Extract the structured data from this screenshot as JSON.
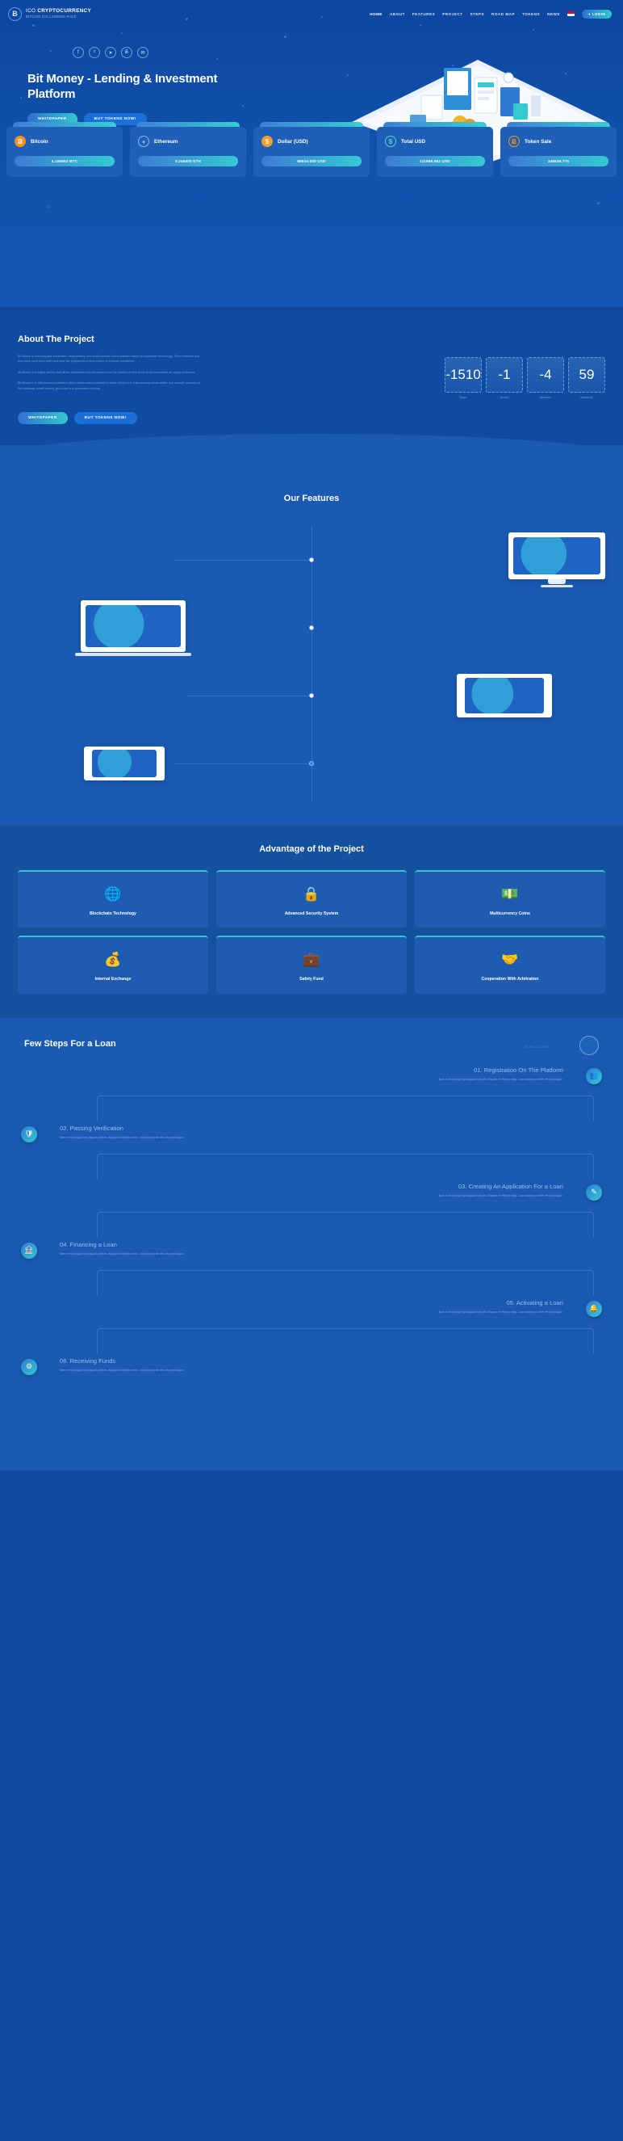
{
  "header": {
    "brand_line1_light": "ICO ",
    "brand_line1_bold": "CRYPTOCURRENCY",
    "brand_line2": "BITCOIN ICO LANDING PAGE",
    "logo_glyph": "Ƀ",
    "nav": [
      {
        "label": "HOME",
        "active": true
      },
      {
        "label": "ABOUT",
        "active": false
      },
      {
        "label": "FEATURES",
        "active": false
      },
      {
        "label": "PROJECT",
        "active": false
      },
      {
        "label": "STEPS",
        "active": false
      },
      {
        "label": "ROAD MAP",
        "active": false
      },
      {
        "label": "TOKENS",
        "active": false
      },
      {
        "label": "NEWS",
        "active": false
      }
    ],
    "login_label": "LOGIN",
    "login_icon": "👤",
    "flag_name": "flag-icon"
  },
  "hero": {
    "socials": [
      {
        "name": "facebook-icon",
        "glyph": "f"
      },
      {
        "name": "twitter-icon",
        "glyph": "ᴛ"
      },
      {
        "name": "telegram-icon",
        "glyph": "➤"
      },
      {
        "name": "bitcoin-icon",
        "glyph": "Ƀ"
      },
      {
        "name": "email-icon",
        "glyph": "✉"
      }
    ],
    "title": "Bit Money - Lending & Investment Platform",
    "btn_primary": "WHITEPAPER",
    "btn_secondary": "BUY TOKENS NOW!"
  },
  "tickers": [
    {
      "name": "Bitcoin",
      "value": "4.160651 BTC",
      "icon": "Ƀ",
      "icon_bg": "#f7931a",
      "icon_fg": "#ffffff"
    },
    {
      "name": "Ethereum",
      "value": "3.245000 ETH",
      "icon": "♦",
      "icon_bg": "transparent",
      "icon_fg": "#8fb6e8"
    },
    {
      "name": "Dollar (USD)",
      "value": "58634.000 USD",
      "icon": "$",
      "icon_bg": "#f0a02a",
      "icon_fg": "#ffffff"
    },
    {
      "name": "Total USD",
      "value": "111969.062 USD",
      "icon": "$",
      "icon_bg": "transparent",
      "icon_fg": "#4fd8c0"
    },
    {
      "name": "Token Sale",
      "value": "346636.775",
      "icon": "Ƀ",
      "icon_bg": "transparent",
      "icon_fg": "#f7931a"
    }
  ],
  "about": {
    "title": "About The Project",
    "paragraphs": [
      "Bit Money is a lending and investment, multicurrency and multifunctional online platform based on blockchain technology. There investors and borrowers meet each other and have the opportunity to lend money or evaluate investment.",
      "Bit Money is a unique service that allows individuals to invest money from the comfort of their home in the convenient on crypto currencies.",
      "Bit Money is a multi-functional platform which allows each participant to keep money in a multi-currency online wallet, buy and sell currency on the exchange, invest money, get a loan in a convenient currency."
    ],
    "btn_primary": "WHITEPAPER",
    "btn_secondary": "BUY TOKENS NOW!",
    "countdown": [
      {
        "value": "-1510",
        "label": "Days"
      },
      {
        "value": "-1",
        "label": "Hours"
      },
      {
        "value": "-4",
        "label": "Minutes"
      },
      {
        "value": "59",
        "label": "Seconds"
      }
    ]
  },
  "features": {
    "title": "Our Features",
    "items": [
      {
        "device": "desktop",
        "name": "feature-desktop"
      },
      {
        "device": "laptop",
        "name": "feature-laptop"
      },
      {
        "device": "tablet",
        "name": "feature-tablet"
      },
      {
        "device": "phone",
        "name": "feature-phone"
      }
    ]
  },
  "advantages": {
    "title": "Advantage of the Project",
    "items": [
      {
        "label": "Blockchain Technology",
        "icon": "🌐",
        "name": "advantage-blockchain-technology"
      },
      {
        "label": "Advanced Security System",
        "icon": "🔒",
        "name": "advantage-advanced-security-system"
      },
      {
        "label": "Multicurrency Coins",
        "icon": "💵",
        "name": "advantage-multicurrency-coins"
      },
      {
        "label": "Internal Exchange",
        "icon": "💰",
        "name": "advantage-internal-exchange"
      },
      {
        "label": "Safety Fund",
        "icon": "💼",
        "name": "advantage-safety-fund"
      },
      {
        "label": "Cooperation With Arbitration",
        "icon": "🤝",
        "name": "advantage-cooperation-with-arbitration"
      }
    ]
  },
  "steps": {
    "title": "Few Steps For a Loan",
    "subtitle": "SCROLL DOWN",
    "desc": "Nam in lectus eget nisi aliquam ultrices. Aliquam at efficitur nulla. Cras sodales eu nibh vel scelerisque.",
    "items": [
      {
        "title": "01. Registration On The Platform",
        "icon": "👥",
        "side": "right"
      },
      {
        "title": "02. Passing Verification",
        "icon": "🛡",
        "side": "left"
      },
      {
        "title": "03. Creating An Application For a Loan",
        "icon": "✎",
        "side": "right"
      },
      {
        "title": "04. Financing a Loan",
        "icon": "🏦",
        "side": "left"
      },
      {
        "title": "05. Activating a Loan",
        "icon": "🔔",
        "side": "right"
      },
      {
        "title": "06. Receiving Funds",
        "icon": "⚙",
        "side": "left"
      }
    ]
  },
  "colors": {
    "bg_deep": "#0c47a0",
    "bg_mid": "#1a5ab3",
    "bg_panel": "#14519f",
    "card": "#1f5fb8",
    "accent_blue": "#2f7ad3",
    "accent_teal": "#35c9d1",
    "muted_text": "#6e9bd8"
  }
}
